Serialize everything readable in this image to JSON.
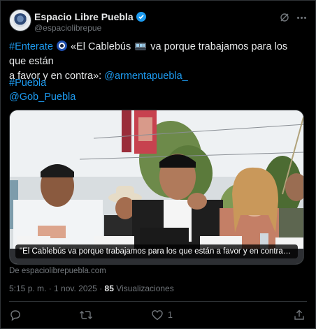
{
  "post": {
    "author_name": "Espacio Libre Puebla",
    "author_handle": "@espaciolibrepue",
    "text": {
      "hashtag1": "#Enterate",
      "quote": "«El Cablebús",
      "quote_rest": "va porque trabajamos para los que están",
      "line2_start": "a favor y en contra»:",
      "mention1": "@armentapuebla_",
      "hashtag2": "#Puebla",
      "mention2": "@Gob_Puebla"
    },
    "media": {
      "caption": "\"El Cablebús va porque trabajamos para los que están a favor y en contra\": Armenta - ...",
      "source": "De espaciolibrepuebla.com"
    },
    "time": "5:15 p. m. · 1 nov. 2025 ·",
    "views_count": "85",
    "views_label": "Visualizaciones",
    "actions": {
      "likes": "1"
    }
  },
  "colors": {
    "accent": "#1d9bf0",
    "text": "#e7e9ea",
    "muted": "#71767b",
    "border": "#2f3336",
    "background": "#000000"
  },
  "icons": [
    "verified-badge-icon",
    "grok-icon",
    "more-icon",
    "reply-icon",
    "repost-icon",
    "like-icon",
    "share-icon"
  ]
}
